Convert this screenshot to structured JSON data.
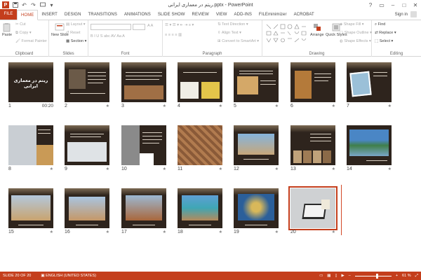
{
  "window": {
    "title": "ریتم در معماری ایرانی.pptx - PowerPoint",
    "app_icon_letter": "P"
  },
  "tabs": [
    {
      "label": "FILE"
    },
    {
      "label": "HOME"
    },
    {
      "label": "INSERT"
    },
    {
      "label": "DESIGN"
    },
    {
      "label": "TRANSITIONS"
    },
    {
      "label": "ANIMATIONS"
    },
    {
      "label": "SLIDE SHOW"
    },
    {
      "label": "REVIEW"
    },
    {
      "label": "VIEW"
    },
    {
      "label": "ADD-INS"
    },
    {
      "label": "FILEminimizer"
    },
    {
      "label": "ACROBAT"
    }
  ],
  "account": {
    "signin": "Sign in"
  },
  "ribbon": {
    "clipboard": {
      "label": "Clipboard",
      "paste": "Paste",
      "cut": "Cut",
      "copy": "Copy",
      "format_painter": "Format Painter"
    },
    "slides": {
      "label": "Slides",
      "new_slide": "New Slide",
      "layout": "Layout",
      "reset": "Reset",
      "section": "Section"
    },
    "font": {
      "label": "Font"
    },
    "paragraph": {
      "label": "Paragraph",
      "text_direction": "Text Direction",
      "align_text": "Align Text",
      "convert": "Convert to SmartArt"
    },
    "drawing": {
      "label": "Drawing",
      "arrange": "Arrange",
      "quick_styles": "Quick Styles",
      "shape_fill": "Shape Fill",
      "shape_outline": "Shape Outline",
      "shape_effects": "Shape Effects"
    },
    "editing": {
      "label": "Editing",
      "find": "Find",
      "replace": "Replace",
      "select": "Select"
    }
  },
  "slides": [
    {
      "number": "1",
      "timing": "00:20",
      "title": "ریتم در معماری ایرانی"
    },
    {
      "number": "2"
    },
    {
      "number": "3"
    },
    {
      "number": "4"
    },
    {
      "number": "5"
    },
    {
      "number": "6"
    },
    {
      "number": "7"
    },
    {
      "number": "8"
    },
    {
      "number": "9"
    },
    {
      "number": "10"
    },
    {
      "number": "11"
    },
    {
      "number": "12"
    },
    {
      "number": "13"
    },
    {
      "number": "14"
    },
    {
      "number": "15"
    },
    {
      "number": "16"
    },
    {
      "number": "17"
    },
    {
      "number": "18"
    },
    {
      "number": "19"
    },
    {
      "number": "20"
    }
  ],
  "star_glyph": "★",
  "status": {
    "slide_of": "SLIDE 20 OF 20",
    "language": "ENGLISH (UNITED STATES)",
    "zoom": "61 %"
  },
  "colors": {
    "accent": "#c43e1c",
    "slide_bg": "#2e241d"
  }
}
